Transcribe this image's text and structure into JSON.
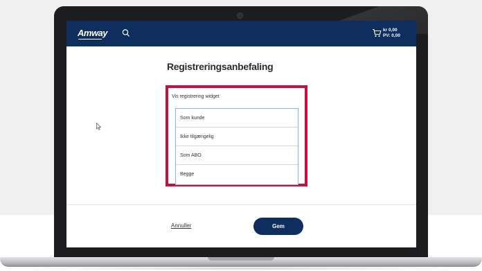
{
  "header": {
    "logo": "Amway",
    "cart_amount": "kr 0,00",
    "cart_pv": "PV: 0,00"
  },
  "page": {
    "title": "Registreringsanbefaling",
    "widget_label": "Vis registrering widget",
    "options": [
      "Som kunde",
      "Ikke tilgængelig",
      "Som ABO",
      "Begge"
    ]
  },
  "footer": {
    "cancel_label": "Annuller",
    "save_label": "Gem"
  },
  "colors": {
    "header_bg": "#0d2e5e",
    "highlight_border": "#c8103e",
    "listbox_border": "#8fb3d9"
  },
  "icons": [
    "search-icon",
    "cart-icon",
    "mouse-cursor-icon",
    "camera-icon"
  ]
}
